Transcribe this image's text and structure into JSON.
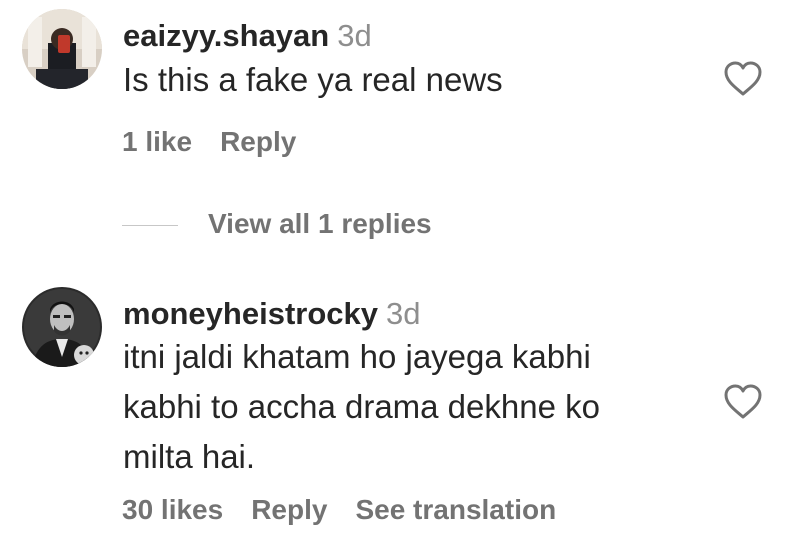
{
  "comments": [
    {
      "username": "eaizyy.shayan",
      "time": "3d",
      "text": "Is this a fake ya real news",
      "likes": "1 like",
      "reply": "Reply"
    },
    {
      "username": "moneyheistrocky",
      "time": "3d",
      "text": "itni jaldi khatam ho jayega kabhi\nkabhi to accha drama dekhne ko\nmilta hai.",
      "likes": "30 likes",
      "reply": "Reply",
      "translate": "See translation"
    }
  ],
  "replies": {
    "label": "View all 1 replies"
  },
  "icons": {
    "heart": "heart-outline-icon"
  },
  "colors": {
    "text": "#262626",
    "secondary": "#737373",
    "timestamp": "#8e8e8e"
  }
}
